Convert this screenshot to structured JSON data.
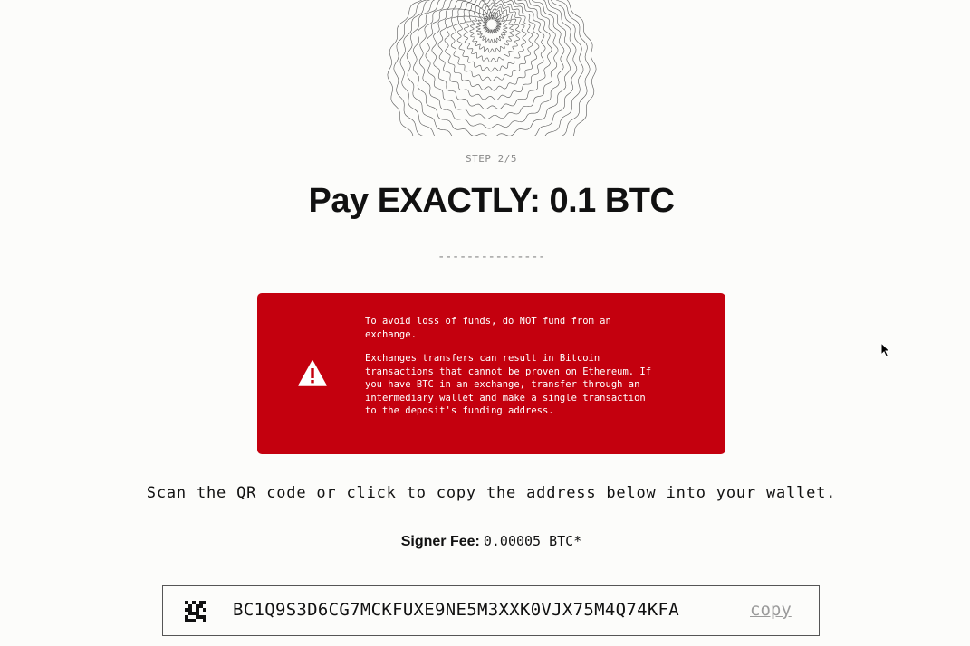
{
  "step": {
    "label": "STEP 2/5"
  },
  "title": "Pay EXACTLY: 0.1 BTC",
  "divider": "---------------",
  "warning": {
    "icon": "warning-triangle-icon",
    "color": "#c4000e",
    "paragraph1": "To avoid loss of funds, do NOT fund from an exchange.",
    "paragraph2": "Exchanges transfers can result in Bitcoin transactions that cannot be proven on Ethereum. If you have BTC in an exchange, transfer through an intermediary wallet and make a single transaction to the deposit's funding address."
  },
  "instruction": "Scan the QR code or click to copy the address below into your wallet.",
  "fee": {
    "label": "Signer Fee:",
    "value": "0.00005 BTC*"
  },
  "address_box": {
    "qr_icon": "qr-code-icon",
    "address": "BC1Q9S3D6CG7MCKFUXE9NE5M3XXK0VJX75M4Q74KFA",
    "copy_label": "copy"
  }
}
